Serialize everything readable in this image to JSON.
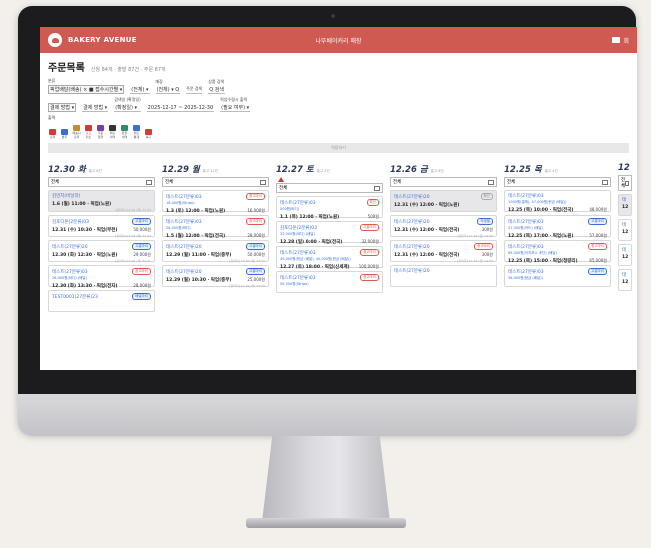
{
  "header": {
    "brand": "BAKERY AVENUE",
    "center_title": "나뚜베이커리 매장",
    "right_label": "회"
  },
  "page": {
    "title": "주문목록",
    "stats": "신청 84개 · 출발 87건 · 주문 87개"
  },
  "filters": {
    "row1": [
      {
        "label": "분류",
        "value": "픽업배달(배송) ×  ■ 접수시간별 ▾"
      },
      {
        "label": "",
        "value": "(전체) ▾"
      },
      {
        "label": "매장",
        "value": "(전체) ▾  Q"
      },
      {
        "label": "주문 검색",
        "value": ""
      },
      {
        "label": "상품 검색",
        "value": "Q 검색"
      }
    ],
    "row2": [
      {
        "label": "",
        "value": "결제 방법 ▾"
      },
      {
        "label": "",
        "value": "결제 방법 ▾"
      },
      {
        "label": "검색일 (확정일)",
        "value": "(확정일) ▾"
      },
      {
        "label": "",
        "value": "2025-12-17 ~ 2025-12-30"
      },
      {
        "label": "픽업수령시 출력",
        "value": "(필요 여부) ▾"
      }
    ]
  },
  "toolbar": {
    "label": "출력",
    "tools": [
      {
        "name": "출력",
        "color": "#d43b32"
      },
      {
        "name": "발주",
        "color": "#3a6fd8"
      },
      {
        "name": "배송지 출력",
        "color": "#c98a2b"
      },
      {
        "name": "출고 취소",
        "color": "#d43b32"
      },
      {
        "name": "주문 일괄",
        "color": "#7a3fa8"
      },
      {
        "name": "매출 내역",
        "color": "#333333"
      },
      {
        "name": "환불 내역",
        "color": "#2a8f5a"
      },
      {
        "name": "매출 통계",
        "color": "#3a6fd8"
      },
      {
        "name": "복구",
        "color": "#d43b32"
      }
    ]
  },
  "search_bar": {
    "text": "적용하기"
  },
  "columns": [
    {
      "date": "12.30 화",
      "count": "출고 8건",
      "filter": "전체",
      "warn": false,
      "cards": [
        {
          "name": "김민지(바닐라)",
          "tag": "",
          "tag_style": "grey",
          "sub": "",
          "line": "1.6 (월) 11:00 · 픽업(노원)",
          "price": "",
          "meta": "[관리자] 12.26 (목) 22:04",
          "grey": true
        },
        {
          "name": "김포디온(2분류)03",
          "tag": "고흥마리",
          "tag_style": "blue",
          "sub": "",
          "line": "12.31 (수) 10:30 · 픽업(부천)",
          "price": "50,000원",
          "meta": "[관리자] 12.26 (목) 22:04",
          "grey": false
        },
        {
          "name": "테스트(27분류)20",
          "tag": "고흥마리",
          "tag_style": "blue",
          "sub": "",
          "line": "12.30 (화) 12:30 · 픽업(노원)",
          "price": "29,000원",
          "meta": "[관리자] 12.26 (목) 23:41",
          "grey": false
        },
        {
          "name": "테스트(27분류)03",
          "tag": "중고마리",
          "tag_style": "red",
          "sub": "26,000원(바디) (배달)",
          "line": "12.30 (화) 13:30 · 픽업(전자)",
          "price": "28,000원",
          "meta": "[관리자] 12.26 (목) 23:41",
          "grey": false
        },
        {
          "name": "TEST0001(27분류)23",
          "tag": "배달마리",
          "tag_style": "blue",
          "sub": "",
          "line": "",
          "price": "",
          "meta": "",
          "grey": false
        }
      ]
    },
    {
      "date": "12.29 월",
      "count": "출고 12건",
      "filter": "전체",
      "warn": false,
      "cards": [
        {
          "name": "테스트(27분류)03",
          "tag": "중고마리",
          "tag_style": "red",
          "sub": "16,000원(Stripe)",
          "line": "1.3 (토) 12:00 · 픽업(노원)",
          "price": "16,000원",
          "meta": "[관리자] 12.26 (목) 23:50",
          "grey": false
        },
        {
          "name": "테스트(27분류)03",
          "tag": "중고마리",
          "tag_style": "red",
          "sub": "28,000원(바디)",
          "line": "1.5 (월) 12:00 · 픽업(전국)",
          "price": "28,000원",
          "meta": "[관리자] 12.26 (목) 23:41",
          "grey": false
        },
        {
          "name": "테스트(27분류)20",
          "tag": "고흥마리",
          "tag_style": "blue",
          "sub": "",
          "line": "12.29 (월) 11:00 · 픽업(중부)",
          "price": "50,000원",
          "meta": "[관리자] 12.26 (목) 23:50",
          "grey": false
        },
        {
          "name": "테스트(27분류)20",
          "tag": "고흥마리",
          "tag_style": "blue",
          "sub": "",
          "line": "12.29 (월) 10:30 · 픽업(중부)",
          "price": "25,000원",
          "meta": "[관리자] 12.26 (목) 23:50",
          "grey": false
        }
      ]
    },
    {
      "date": "12.27 토",
      "count": "출고 4건",
      "filter": "전체",
      "warn": true,
      "cards": [
        {
          "name": "테스트(27분류)03",
          "tag": "확인",
          "tag_style": "red",
          "sub": "500원(바디)",
          "line": "1.1 (목) 12:00 · 픽업(노원)",
          "price": "500원",
          "meta": "[관리자] 12.27 (토) 16:57",
          "grey": false
        },
        {
          "name": "김포디온(2분류)03",
          "tag": "고흥마리",
          "tag_style": "red",
          "sub": "32,000원(바디) (배달)",
          "line": "12.28 (일) 0:00 · 픽업(전국)",
          "price": "32,000원",
          "meta": "[관리자] 12.27 (토) 18:11",
          "grey": false
        },
        {
          "name": "테스트(27분류)03",
          "tag": "중고마리",
          "tag_style": "red",
          "sub": "49,000원(현금 (배달), 40,000원(현금 (배달))",
          "line": "12.27 (토) 18:00 · 픽업(신세계)",
          "price": "100,000원",
          "meta": "[관리자] 12.27 (토) 18:07",
          "grey": false
        },
        {
          "name": "테스트(27분류)03",
          "tag": "중고마리",
          "tag_style": "red",
          "sub": "59,500원(Stripe)",
          "line": "",
          "price": "",
          "meta": "",
          "grey": false
        }
      ]
    },
    {
      "date": "12.26 금",
      "count": "출고 8건",
      "filter": "전체",
      "warn": false,
      "cards": [
        {
          "name": "테스트(27분류)20",
          "tag": "확인",
          "tag_style": "grey",
          "sub": "",
          "line": "12.31 (수) 12:00 · 픽업(노원)",
          "price": "",
          "meta": "",
          "grey": true
        },
        {
          "name": "테스트(27분류)20",
          "tag": "차생필",
          "tag_style": "blue",
          "sub": "",
          "line": "12.31 (수) 12:00 · 픽업(전국)",
          "price": "300원",
          "meta": "[관리자] 12.26 (금) 13:58",
          "grey": false
        },
        {
          "name": "테스트(27분류)20",
          "tag": "중고마리",
          "tag_style": "red",
          "sub": "",
          "line": "12.31 (수) 12:00 · 픽업(전국)",
          "price": "300원",
          "meta": "[관리자] 12.26 (금) 13:58",
          "grey": false
        },
        {
          "name": "테스트(27분류)20",
          "tag": "",
          "tag_style": "grey",
          "sub": "",
          "line": "",
          "price": "",
          "meta": "",
          "grey": false
        }
      ]
    },
    {
      "date": "12.25 목",
      "count": "출고 4건",
      "filter": "전체",
      "warn": false,
      "cards": [
        {
          "name": "테스트(27분류)03",
          "tag": "",
          "tag_style": "grey",
          "sub": "1000원(결제), 47,000원(현금 (배달))",
          "line": "12.25 (목) 10:00 · 픽업(전국)",
          "price": "48,000원",
          "meta": "[관리자] 12.25 (목) 22:07",
          "grey": false
        },
        {
          "name": "테스트(27분류)03",
          "tag": "고흥마리",
          "tag_style": "blue",
          "sub": "57,000원(카드) (배달)",
          "line": "12.25 (목) 17:00 · 픽업(노원)",
          "price": "57,000원",
          "meta": "[관리자] 12.25 (목) 23:51",
          "grey": false
        },
        {
          "name": "테스트(27분류)03",
          "tag": "중고마리",
          "tag_style": "red",
          "sub": "65,000원(이지포스 조단) (배달)",
          "line": "12.25 (목) 15:00 · 픽업(청량리)",
          "price": "65,000원",
          "meta": "[관리자] 12.26 (금) 23:51",
          "grey": false
        },
        {
          "name": "테스트(27분류)03",
          "tag": "고흥마리",
          "tag_style": "blue",
          "sub": "36,000원(현금 (배달))",
          "line": "",
          "price": "",
          "meta": "",
          "grey": false
        }
      ]
    },
    {
      "date": "12",
      "count": "",
      "filter": "전체",
      "warn": false,
      "cards": [
        {
          "name": "테",
          "tag": "",
          "tag_style": "grey",
          "sub": "",
          "line": "12",
          "price": "",
          "meta": "",
          "grey": true
        },
        {
          "name": "테",
          "tag": "",
          "tag_style": "grey",
          "sub": "",
          "line": "12",
          "price": "",
          "meta": "",
          "grey": false
        },
        {
          "name": "테",
          "tag": "",
          "tag_style": "grey",
          "sub": "",
          "line": "12",
          "price": "",
          "meta": "",
          "grey": false
        },
        {
          "name": "테",
          "tag": "",
          "tag_style": "grey",
          "sub": "",
          "line": "12",
          "price": "",
          "meta": "",
          "grey": false
        }
      ]
    }
  ]
}
